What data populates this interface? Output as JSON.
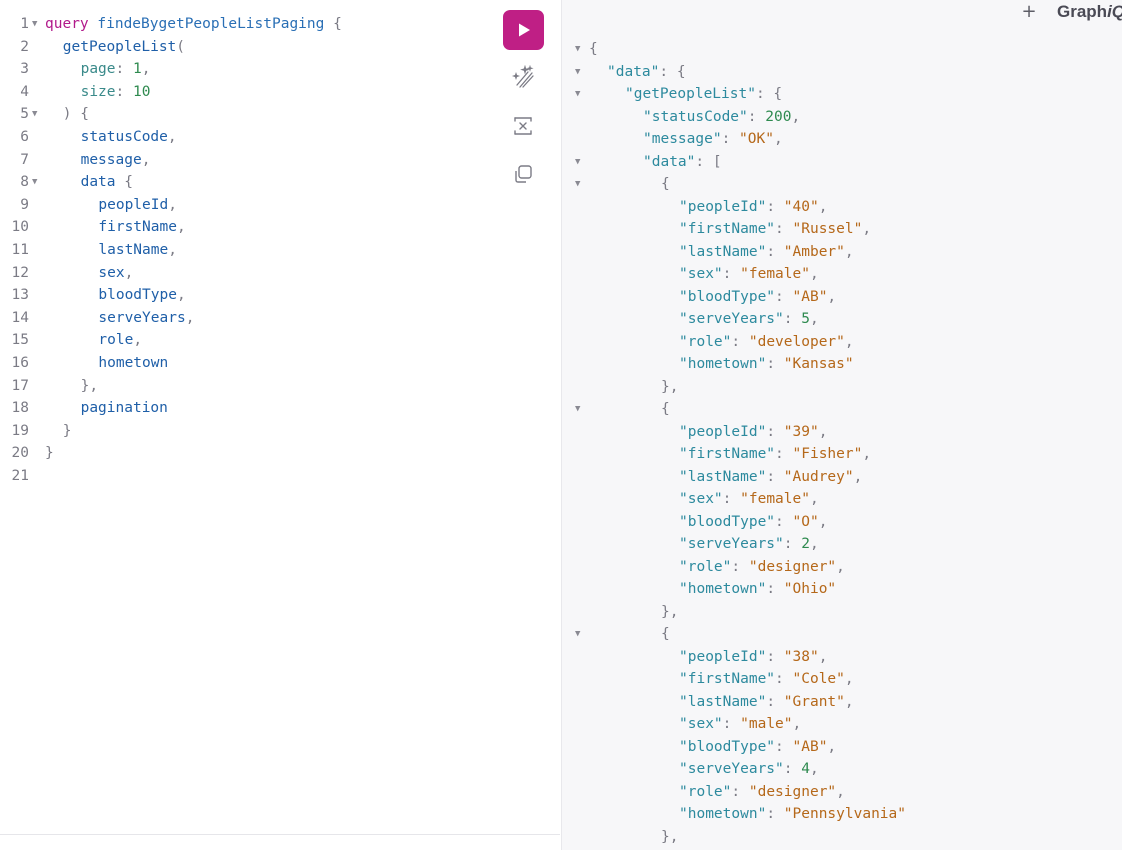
{
  "header": {
    "add_tab_label": "+",
    "logo_main": "Graph",
    "logo_italic": "iQ"
  },
  "toolbar": {
    "run_icon": "play-icon",
    "prettify_icon": "magic-wand-icon",
    "merge_icon": "merge-fragments-icon",
    "copy_icon": "copy-icon"
  },
  "editor": {
    "lines": [
      {
        "num": "1",
        "fold": true,
        "indent": 0,
        "tokens": [
          [
            "kw",
            "query"
          ],
          [
            "plain",
            " "
          ],
          [
            "def",
            "findeBygetPeopleListPaging"
          ],
          [
            "plain",
            " "
          ],
          [
            "punc",
            "{"
          ]
        ]
      },
      {
        "num": "2",
        "fold": false,
        "indent": 2,
        "tokens": [
          [
            "fld",
            "getPeopleList"
          ],
          [
            "punc",
            "("
          ]
        ]
      },
      {
        "num": "3",
        "fold": false,
        "indent": 4,
        "tokens": [
          [
            "arg",
            "page"
          ],
          [
            "punc",
            ":"
          ],
          [
            "plain",
            " "
          ],
          [
            "num",
            "1"
          ],
          [
            "punc",
            ","
          ]
        ]
      },
      {
        "num": "4",
        "fold": false,
        "indent": 4,
        "tokens": [
          [
            "arg",
            "size"
          ],
          [
            "punc",
            ":"
          ],
          [
            "plain",
            " "
          ],
          [
            "num",
            "10"
          ]
        ]
      },
      {
        "num": "5",
        "fold": true,
        "indent": 2,
        "tokens": [
          [
            "punc",
            ")"
          ],
          [
            "plain",
            " "
          ],
          [
            "punc",
            "{"
          ]
        ]
      },
      {
        "num": "6",
        "fold": false,
        "indent": 4,
        "tokens": [
          [
            "fld",
            "statusCode"
          ],
          [
            "punc",
            ","
          ]
        ]
      },
      {
        "num": "7",
        "fold": false,
        "indent": 4,
        "tokens": [
          [
            "fld",
            "message"
          ],
          [
            "punc",
            ","
          ]
        ]
      },
      {
        "num": "8",
        "fold": true,
        "indent": 4,
        "tokens": [
          [
            "fld",
            "data"
          ],
          [
            "plain",
            " "
          ],
          [
            "punc",
            "{"
          ]
        ]
      },
      {
        "num": "9",
        "fold": false,
        "indent": 6,
        "tokens": [
          [
            "fld",
            "peopleId"
          ],
          [
            "punc",
            ","
          ]
        ]
      },
      {
        "num": "10",
        "fold": false,
        "indent": 6,
        "tokens": [
          [
            "fld",
            "firstName"
          ],
          [
            "punc",
            ","
          ]
        ]
      },
      {
        "num": "11",
        "fold": false,
        "indent": 6,
        "tokens": [
          [
            "fld",
            "lastName"
          ],
          [
            "punc",
            ","
          ]
        ]
      },
      {
        "num": "12",
        "fold": false,
        "indent": 6,
        "tokens": [
          [
            "fld",
            "sex"
          ],
          [
            "punc",
            ","
          ]
        ]
      },
      {
        "num": "13",
        "fold": false,
        "indent": 6,
        "tokens": [
          [
            "fld",
            "bloodType"
          ],
          [
            "punc",
            ","
          ]
        ]
      },
      {
        "num": "14",
        "fold": false,
        "indent": 6,
        "tokens": [
          [
            "fld",
            "serveYears"
          ],
          [
            "punc",
            ","
          ]
        ]
      },
      {
        "num": "15",
        "fold": false,
        "indent": 6,
        "tokens": [
          [
            "fld",
            "role"
          ],
          [
            "punc",
            ","
          ]
        ]
      },
      {
        "num": "16",
        "fold": false,
        "indent": 6,
        "tokens": [
          [
            "fld",
            "hometown"
          ]
        ]
      },
      {
        "num": "17",
        "fold": false,
        "indent": 4,
        "tokens": [
          [
            "punc",
            "},"
          ]
        ]
      },
      {
        "num": "18",
        "fold": false,
        "indent": 4,
        "tokens": [
          [
            "fld",
            "pagination"
          ]
        ]
      },
      {
        "num": "19",
        "fold": false,
        "indent": 2,
        "tokens": [
          [
            "punc",
            "}"
          ]
        ]
      },
      {
        "num": "20",
        "fold": false,
        "indent": 0,
        "tokens": [
          [
            "punc",
            "}"
          ]
        ]
      },
      {
        "num": "21",
        "fold": false,
        "indent": 0,
        "tokens": []
      }
    ]
  },
  "result": {
    "lines": [
      {
        "fold": true,
        "indent": 0,
        "tokens": [
          [
            "punc",
            "{"
          ]
        ]
      },
      {
        "fold": true,
        "indent": 1,
        "tokens": [
          [
            "key",
            "\"data\""
          ],
          [
            "punc",
            ": {"
          ]
        ]
      },
      {
        "fold": true,
        "indent": 2,
        "tokens": [
          [
            "key",
            "\"getPeopleList\""
          ],
          [
            "punc",
            ": {"
          ]
        ]
      },
      {
        "fold": false,
        "indent": 3,
        "tokens": [
          [
            "key",
            "\"statusCode\""
          ],
          [
            "punc",
            ": "
          ],
          [
            "rnum",
            "200"
          ],
          [
            "punc",
            ","
          ]
        ]
      },
      {
        "fold": false,
        "indent": 3,
        "tokens": [
          [
            "key",
            "\"message\""
          ],
          [
            "punc",
            ": "
          ],
          [
            "str",
            "\"OK\""
          ],
          [
            "punc",
            ","
          ]
        ]
      },
      {
        "fold": true,
        "indent": 3,
        "tokens": [
          [
            "key",
            "\"data\""
          ],
          [
            "punc",
            ": ["
          ]
        ]
      },
      {
        "fold": true,
        "indent": 4,
        "tokens": [
          [
            "punc",
            "{"
          ]
        ]
      },
      {
        "fold": false,
        "indent": 5,
        "tokens": [
          [
            "key",
            "\"peopleId\""
          ],
          [
            "punc",
            ": "
          ],
          [
            "str",
            "\"40\""
          ],
          [
            "punc",
            ","
          ]
        ]
      },
      {
        "fold": false,
        "indent": 5,
        "tokens": [
          [
            "key",
            "\"firstName\""
          ],
          [
            "punc",
            ": "
          ],
          [
            "str",
            "\"Russel\""
          ],
          [
            "punc",
            ","
          ]
        ]
      },
      {
        "fold": false,
        "indent": 5,
        "tokens": [
          [
            "key",
            "\"lastName\""
          ],
          [
            "punc",
            ": "
          ],
          [
            "str",
            "\"Amber\""
          ],
          [
            "punc",
            ","
          ]
        ]
      },
      {
        "fold": false,
        "indent": 5,
        "tokens": [
          [
            "key",
            "\"sex\""
          ],
          [
            "punc",
            ": "
          ],
          [
            "str",
            "\"female\""
          ],
          [
            "punc",
            ","
          ]
        ]
      },
      {
        "fold": false,
        "indent": 5,
        "tokens": [
          [
            "key",
            "\"bloodType\""
          ],
          [
            "punc",
            ": "
          ],
          [
            "str",
            "\"AB\""
          ],
          [
            "punc",
            ","
          ]
        ]
      },
      {
        "fold": false,
        "indent": 5,
        "tokens": [
          [
            "key",
            "\"serveYears\""
          ],
          [
            "punc",
            ": "
          ],
          [
            "rnum",
            "5"
          ],
          [
            "punc",
            ","
          ]
        ]
      },
      {
        "fold": false,
        "indent": 5,
        "tokens": [
          [
            "key",
            "\"role\""
          ],
          [
            "punc",
            ": "
          ],
          [
            "str",
            "\"developer\""
          ],
          [
            "punc",
            ","
          ]
        ]
      },
      {
        "fold": false,
        "indent": 5,
        "tokens": [
          [
            "key",
            "\"hometown\""
          ],
          [
            "punc",
            ": "
          ],
          [
            "str",
            "\"Kansas\""
          ]
        ]
      },
      {
        "fold": false,
        "indent": 4,
        "tokens": [
          [
            "punc",
            "},"
          ]
        ]
      },
      {
        "fold": true,
        "indent": 4,
        "tokens": [
          [
            "punc",
            "{"
          ]
        ]
      },
      {
        "fold": false,
        "indent": 5,
        "tokens": [
          [
            "key",
            "\"peopleId\""
          ],
          [
            "punc",
            ": "
          ],
          [
            "str",
            "\"39\""
          ],
          [
            "punc",
            ","
          ]
        ]
      },
      {
        "fold": false,
        "indent": 5,
        "tokens": [
          [
            "key",
            "\"firstName\""
          ],
          [
            "punc",
            ": "
          ],
          [
            "str",
            "\"Fisher\""
          ],
          [
            "punc",
            ","
          ]
        ]
      },
      {
        "fold": false,
        "indent": 5,
        "tokens": [
          [
            "key",
            "\"lastName\""
          ],
          [
            "punc",
            ": "
          ],
          [
            "str",
            "\"Audrey\""
          ],
          [
            "punc",
            ","
          ]
        ]
      },
      {
        "fold": false,
        "indent": 5,
        "tokens": [
          [
            "key",
            "\"sex\""
          ],
          [
            "punc",
            ": "
          ],
          [
            "str",
            "\"female\""
          ],
          [
            "punc",
            ","
          ]
        ]
      },
      {
        "fold": false,
        "indent": 5,
        "tokens": [
          [
            "key",
            "\"bloodType\""
          ],
          [
            "punc",
            ": "
          ],
          [
            "str",
            "\"O\""
          ],
          [
            "punc",
            ","
          ]
        ]
      },
      {
        "fold": false,
        "indent": 5,
        "tokens": [
          [
            "key",
            "\"serveYears\""
          ],
          [
            "punc",
            ": "
          ],
          [
            "rnum",
            "2"
          ],
          [
            "punc",
            ","
          ]
        ]
      },
      {
        "fold": false,
        "indent": 5,
        "tokens": [
          [
            "key",
            "\"role\""
          ],
          [
            "punc",
            ": "
          ],
          [
            "str",
            "\"designer\""
          ],
          [
            "punc",
            ","
          ]
        ]
      },
      {
        "fold": false,
        "indent": 5,
        "tokens": [
          [
            "key",
            "\"hometown\""
          ],
          [
            "punc",
            ": "
          ],
          [
            "str",
            "\"Ohio\""
          ]
        ]
      },
      {
        "fold": false,
        "indent": 4,
        "tokens": [
          [
            "punc",
            "},"
          ]
        ]
      },
      {
        "fold": true,
        "indent": 4,
        "tokens": [
          [
            "punc",
            "{"
          ]
        ]
      },
      {
        "fold": false,
        "indent": 5,
        "tokens": [
          [
            "key",
            "\"peopleId\""
          ],
          [
            "punc",
            ": "
          ],
          [
            "str",
            "\"38\""
          ],
          [
            "punc",
            ","
          ]
        ]
      },
      {
        "fold": false,
        "indent": 5,
        "tokens": [
          [
            "key",
            "\"firstName\""
          ],
          [
            "punc",
            ": "
          ],
          [
            "str",
            "\"Cole\""
          ],
          [
            "punc",
            ","
          ]
        ]
      },
      {
        "fold": false,
        "indent": 5,
        "tokens": [
          [
            "key",
            "\"lastName\""
          ],
          [
            "punc",
            ": "
          ],
          [
            "str",
            "\"Grant\""
          ],
          [
            "punc",
            ","
          ]
        ]
      },
      {
        "fold": false,
        "indent": 5,
        "tokens": [
          [
            "key",
            "\"sex\""
          ],
          [
            "punc",
            ": "
          ],
          [
            "str",
            "\"male\""
          ],
          [
            "punc",
            ","
          ]
        ]
      },
      {
        "fold": false,
        "indent": 5,
        "tokens": [
          [
            "key",
            "\"bloodType\""
          ],
          [
            "punc",
            ": "
          ],
          [
            "str",
            "\"AB\""
          ],
          [
            "punc",
            ","
          ]
        ]
      },
      {
        "fold": false,
        "indent": 5,
        "tokens": [
          [
            "key",
            "\"serveYears\""
          ],
          [
            "punc",
            ": "
          ],
          [
            "rnum",
            "4"
          ],
          [
            "punc",
            ","
          ]
        ]
      },
      {
        "fold": false,
        "indent": 5,
        "tokens": [
          [
            "key",
            "\"role\""
          ],
          [
            "punc",
            ": "
          ],
          [
            "str",
            "\"designer\""
          ],
          [
            "punc",
            ","
          ]
        ]
      },
      {
        "fold": false,
        "indent": 5,
        "tokens": [
          [
            "key",
            "\"hometown\""
          ],
          [
            "punc",
            ": "
          ],
          [
            "str",
            "\"Pennsylvania\""
          ]
        ]
      },
      {
        "fold": false,
        "indent": 4,
        "tokens": [
          [
            "punc",
            "},"
          ]
        ]
      }
    ]
  },
  "colors": {
    "run_button": "#bf1f85",
    "keyword": "#b11a8b",
    "json_key": "#2d8a9e",
    "json_string": "#b5681a",
    "json_number": "#2e8a4f"
  }
}
